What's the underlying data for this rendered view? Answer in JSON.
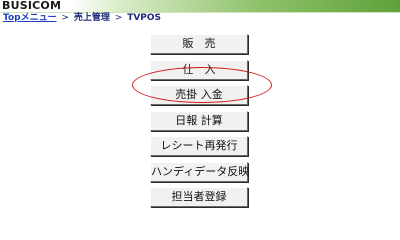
{
  "header": {
    "logo_text": "BUSICOM"
  },
  "breadcrumb": {
    "link": "Topメニュー",
    "sep1": ">",
    "item1": "売上管理",
    "sep2": ">",
    "item2": "TVPOS"
  },
  "menu": {
    "items": [
      {
        "label": "販　売"
      },
      {
        "label": "仕　入"
      },
      {
        "label": "売掛 入金"
      },
      {
        "label": "日報 計算"
      },
      {
        "label": "レシート再発行"
      },
      {
        "label": "ハンディデータ反映"
      },
      {
        "label": "担当者登録"
      }
    ]
  },
  "colors": {
    "highlight": "#d11a1a",
    "header_green": "#5fa23a",
    "link": "#1f3fbf"
  }
}
